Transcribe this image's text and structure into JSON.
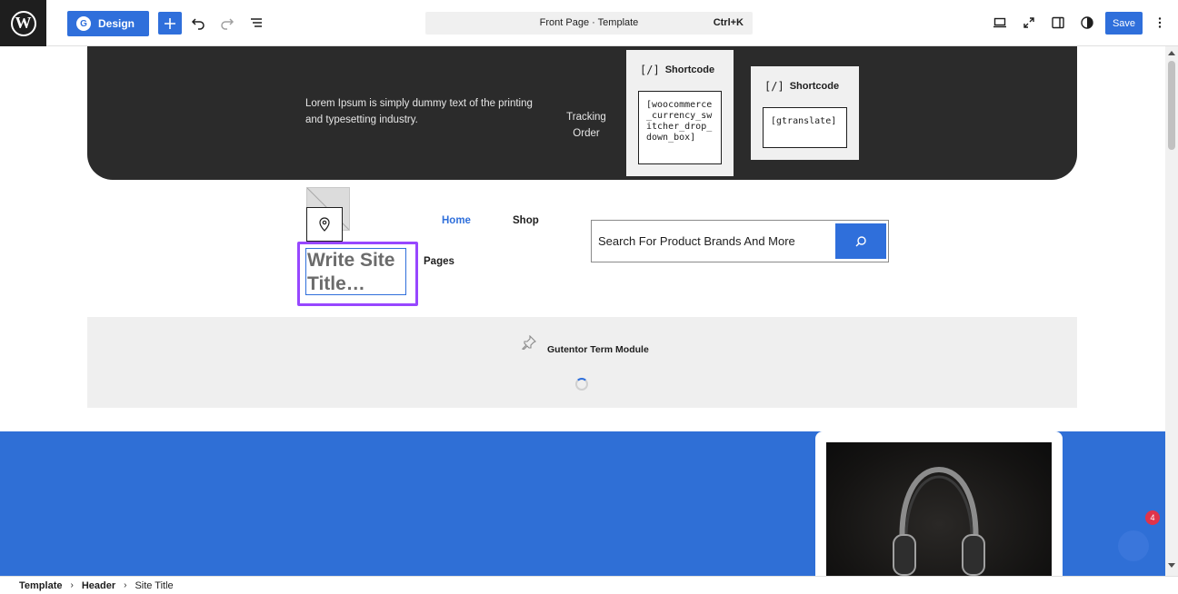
{
  "toolbar": {
    "design_label": "Design",
    "design_badge": "G",
    "wp_letter": "W",
    "command_title": "Front Page · Template",
    "command_shortcut": "Ctrl+K",
    "save_label": "Save"
  },
  "header_top": {
    "lorem": "Lorem Ipsum is simply dummy text of the printing and typesetting industry.",
    "tracking": "Tracking Order",
    "shortcodes": [
      {
        "label": "Shortcode",
        "code": "[woocommerce_currency_switcher_drop_down_box]"
      },
      {
        "label": "Shortcode",
        "code": "[gtranslate]"
      }
    ]
  },
  "header_main": {
    "site_title": "Write Site Title…",
    "nav": {
      "home": "Home",
      "shop": "Shop",
      "pages": "Pages"
    },
    "search_placeholder": "Search For Product Brands And More"
  },
  "term_module": {
    "label": "Gutentor Term Module"
  },
  "notification_count": "4",
  "breadcrumb": {
    "template": "Template",
    "header": "Header",
    "site_title": "Site Title",
    "separator": "›"
  },
  "colors": {
    "accent": "#2f6fdb",
    "selection": "#9747ff",
    "dark_band": "#2b2b2b"
  }
}
